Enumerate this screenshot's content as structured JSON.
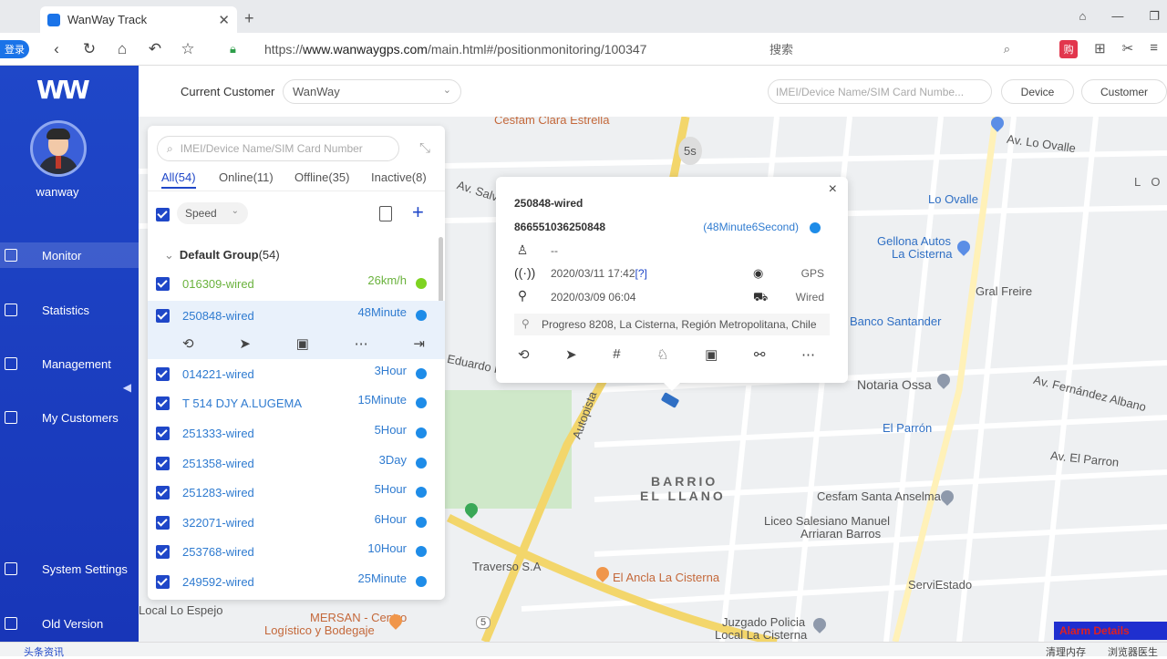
{
  "browser": {
    "tab_title": "WanWay Track",
    "url_scheme": "https://",
    "url_host": "www.wanwaygps.com",
    "url_path": "/main.html#/positionmonitoring/100347",
    "login_badge": "登录",
    "search_placeholder": "搜索",
    "ext_badge": "购"
  },
  "sidebar": {
    "username": "wanway",
    "items": [
      {
        "label": "Monitor"
      },
      {
        "label": "Statistics"
      },
      {
        "label": "Management"
      },
      {
        "label": "My Customers"
      },
      {
        "label": "System Settings"
      },
      {
        "label": "Old Version"
      }
    ]
  },
  "topbar": {
    "customer_label": "Current Customer",
    "customer_value": "WanWay",
    "search_placeholder": "IMEI/Device Name/SIM Card Numbe...",
    "device_button": "Device",
    "customer_button": "Customer"
  },
  "panel": {
    "search_placeholder": "IMEI/Device Name/SIM Card Number",
    "tabs": [
      {
        "label": "All(54)"
      },
      {
        "label": "Online(11)"
      },
      {
        "label": "Offline(35)"
      },
      {
        "label": "Inactive(8)"
      }
    ],
    "sort_label": "Speed",
    "group_name": "Default Group",
    "group_count": "(54)",
    "devices": [
      {
        "name": "016309-wired",
        "status": "26km/h"
      },
      {
        "name": "250848-wired",
        "status": "48Minute"
      },
      {
        "name": "014221-wired",
        "status": "3Hour"
      },
      {
        "name": "T 514 DJY A.LUGEMA",
        "status": "15Minute"
      },
      {
        "name": "251333-wired",
        "status": "5Hour"
      },
      {
        "name": "251358-wired",
        "status": "3Day"
      },
      {
        "name": "251283-wired",
        "status": "5Hour"
      },
      {
        "name": "322071-wired",
        "status": "6Hour"
      },
      {
        "name": "253768-wired",
        "status": "10Hour"
      },
      {
        "name": "249592-wired",
        "status": "25Minute"
      }
    ]
  },
  "popup": {
    "title": "250848-wired",
    "imei": "866551036250848",
    "duration": "(48Minute6Second)",
    "driver": "--",
    "signal_time": "2020/03/11 17:42",
    "signal_help": "[?]",
    "position_type": "GPS",
    "position_time": "2020/03/09 06:04",
    "device_type": "Wired",
    "address": "Progreso 8208, La Cisterna, Región Metropolitana, Chile"
  },
  "map": {
    "labels": {
      "cesfam_clara": "Cesfam Clara Estrella",
      "timer": "5s",
      "lo_ovalle": "Lo Ovalle",
      "av_lo_ovalle": "Av. Lo Ovalle",
      "gellona": "Gellona Autos",
      "la_cisterna": "La Cisterna",
      "gral_freire": "Gral Freire",
      "banco": "Banco Santander",
      "notaria": "Notaria Ossa",
      "el_parron": "El Parrón",
      "barrio1": "BARRIO",
      "barrio2": "EL LLANO",
      "cesfam_santa": "Cesfam Santa Anselma",
      "liceo1": "Liceo Salesiano Manuel",
      "liceo2": "Arriaran Barros",
      "traverso": "Traverso S.A",
      "el_ancla": "El Ancla La Cisterna",
      "serviestado": "ServiEstado",
      "mersan1": "MERSAN - Centro",
      "mersan2": "Logístico y Bodegaje",
      "juzgado1": "Juzgado Policia",
      "juzgado2": "Local La Cisterna",
      "lo_espejo": "Local Lo Espejo",
      "av_salvador": "Av. Salvador",
      "eduardo": "Eduardo F",
      "autopista": "Autopista",
      "av_parron": "Av. El Parron",
      "av_fernandez": "Av. Fernández Albano",
      "lo_right": "L O",
      "route5": "5"
    }
  },
  "alarm_label": "Alarm Details",
  "statusbar": {
    "left": "头条资讯",
    "r1": "清理内存",
    "r2": "浏览器医生"
  },
  "colors": {
    "sidebar": "#1f47c8",
    "accent": "#1f47c8",
    "link": "#2f7bd0",
    "online": "#7ed321",
    "offline_dot": "#1e8ce8",
    "road": "#f3d66b"
  }
}
